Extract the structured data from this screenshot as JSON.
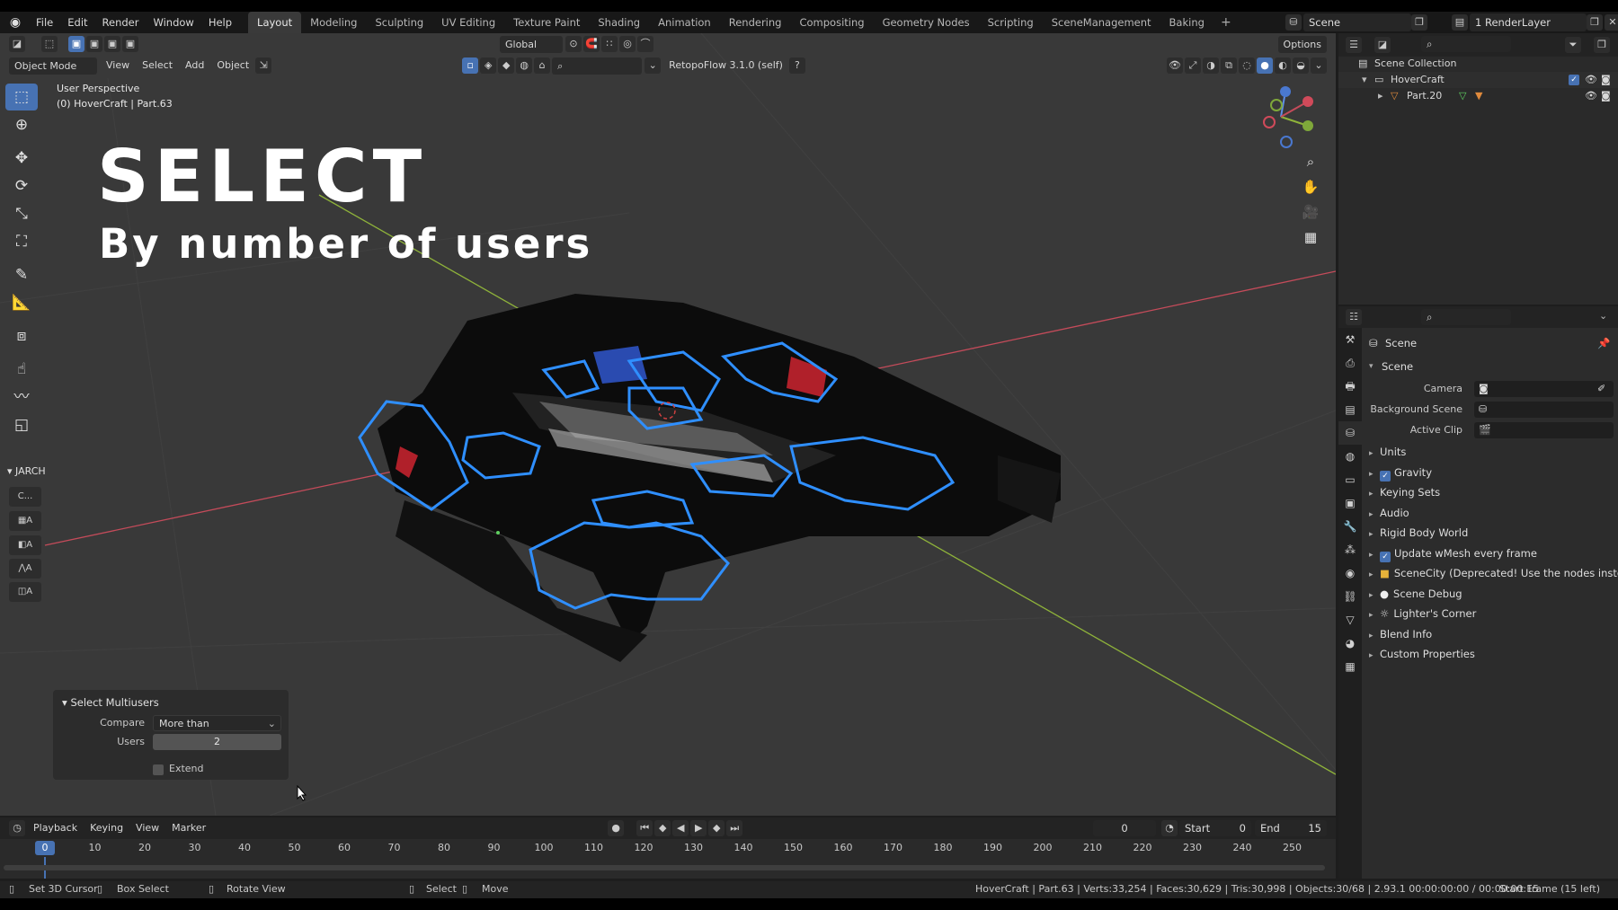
{
  "topmenu": {
    "items": [
      "File",
      "Edit",
      "Render",
      "Window",
      "Help"
    ],
    "workspaces": [
      "Layout",
      "Modeling",
      "Sculpting",
      "UV Editing",
      "Texture Paint",
      "Shading",
      "Animation",
      "Rendering",
      "Compositing",
      "Geometry Nodes",
      "Scripting",
      "SceneManagement",
      "Baking"
    ],
    "active_workspace": "Layout",
    "add_workspace": "+",
    "scene": "Scene",
    "render_layer": "1 RenderLayer"
  },
  "viewport": {
    "mode": "Object Mode",
    "menus": [
      "View",
      "Select",
      "Add",
      "Object"
    ],
    "orientation": "Global",
    "options": "Options",
    "addon": "RetopoFlow 3.1.0 (self)",
    "perspective": "User Perspective",
    "object_info": "(0) HoverCraft | Part.63"
  },
  "overlay_text": {
    "title": "SELECT",
    "subtitle": "By number of users"
  },
  "jarch": {
    "header": "JARCH",
    "buttons": [
      "C...",
      "A",
      "A",
      "A",
      "A"
    ]
  },
  "operator_panel": {
    "title": "Select Multiusers",
    "compare_label": "Compare",
    "compare_value": "More than",
    "users_label": "Users",
    "users_value": "2",
    "extend_label": "Extend"
  },
  "timeline": {
    "menus": [
      "Playback",
      "Keying",
      "View",
      "Marker"
    ],
    "current_frame": "0",
    "start_label": "Start",
    "start_value": "0",
    "end_label": "End",
    "end_value": "15",
    "ruler": [
      "0",
      "10",
      "20",
      "30",
      "40",
      "50",
      "60",
      "70",
      "80",
      "90",
      "100",
      "110",
      "120",
      "130",
      "140",
      "150",
      "160",
      "170",
      "180",
      "190",
      "200",
      "210",
      "220",
      "230",
      "240",
      "250"
    ]
  },
  "statusbar": {
    "set_cursor": "Set 3D Cursor",
    "box_select": "Box Select",
    "rotate_view": "Rotate View",
    "select": "Select",
    "move": "Move",
    "stats": "HoverCraft | Part.63 | Verts:33,254 | Faces:30,629 | Tris:30,998 | Objects:30/68 | 2.93.1  00:00:00:00 / 00:00:00:15",
    "start_frame": "Start Frame (15 left)"
  },
  "outliner": {
    "root": "Scene Collection",
    "collection": "HoverCraft",
    "object": "Part.20"
  },
  "properties": {
    "context": "Scene",
    "panel": "Scene",
    "camera_label": "Camera",
    "background_scene_label": "Background Scene",
    "active_clip_label": "Active Clip",
    "sections": [
      {
        "label": "Units",
        "check": false,
        "icon": ""
      },
      {
        "label": "Gravity",
        "check": true,
        "icon": ""
      },
      {
        "label": "Keying Sets",
        "check": false,
        "icon": ""
      },
      {
        "label": "Audio",
        "check": false,
        "icon": ""
      },
      {
        "label": "Rigid Body World",
        "check": false,
        "icon": ""
      },
      {
        "label": "Update wMesh every frame",
        "check": true,
        "icon": ""
      },
      {
        "label": "SceneCity (Deprecated! Use the nodes instead)",
        "check": false,
        "icon": "yellow-square-icon"
      },
      {
        "label": "Scene Debug",
        "check": false,
        "icon": "white-dot-icon"
      },
      {
        "label": "Lighter's Corner",
        "check": false,
        "icon": "sun-icon"
      },
      {
        "label": "Blend Info",
        "check": false,
        "icon": ""
      },
      {
        "label": "Custom Properties",
        "check": false,
        "icon": ""
      }
    ]
  },
  "colors": {
    "accent": "#4772b3",
    "selection_outline": "#2f8fff",
    "axis_x": "#c44b5a",
    "axis_y": "#8fb33a"
  }
}
